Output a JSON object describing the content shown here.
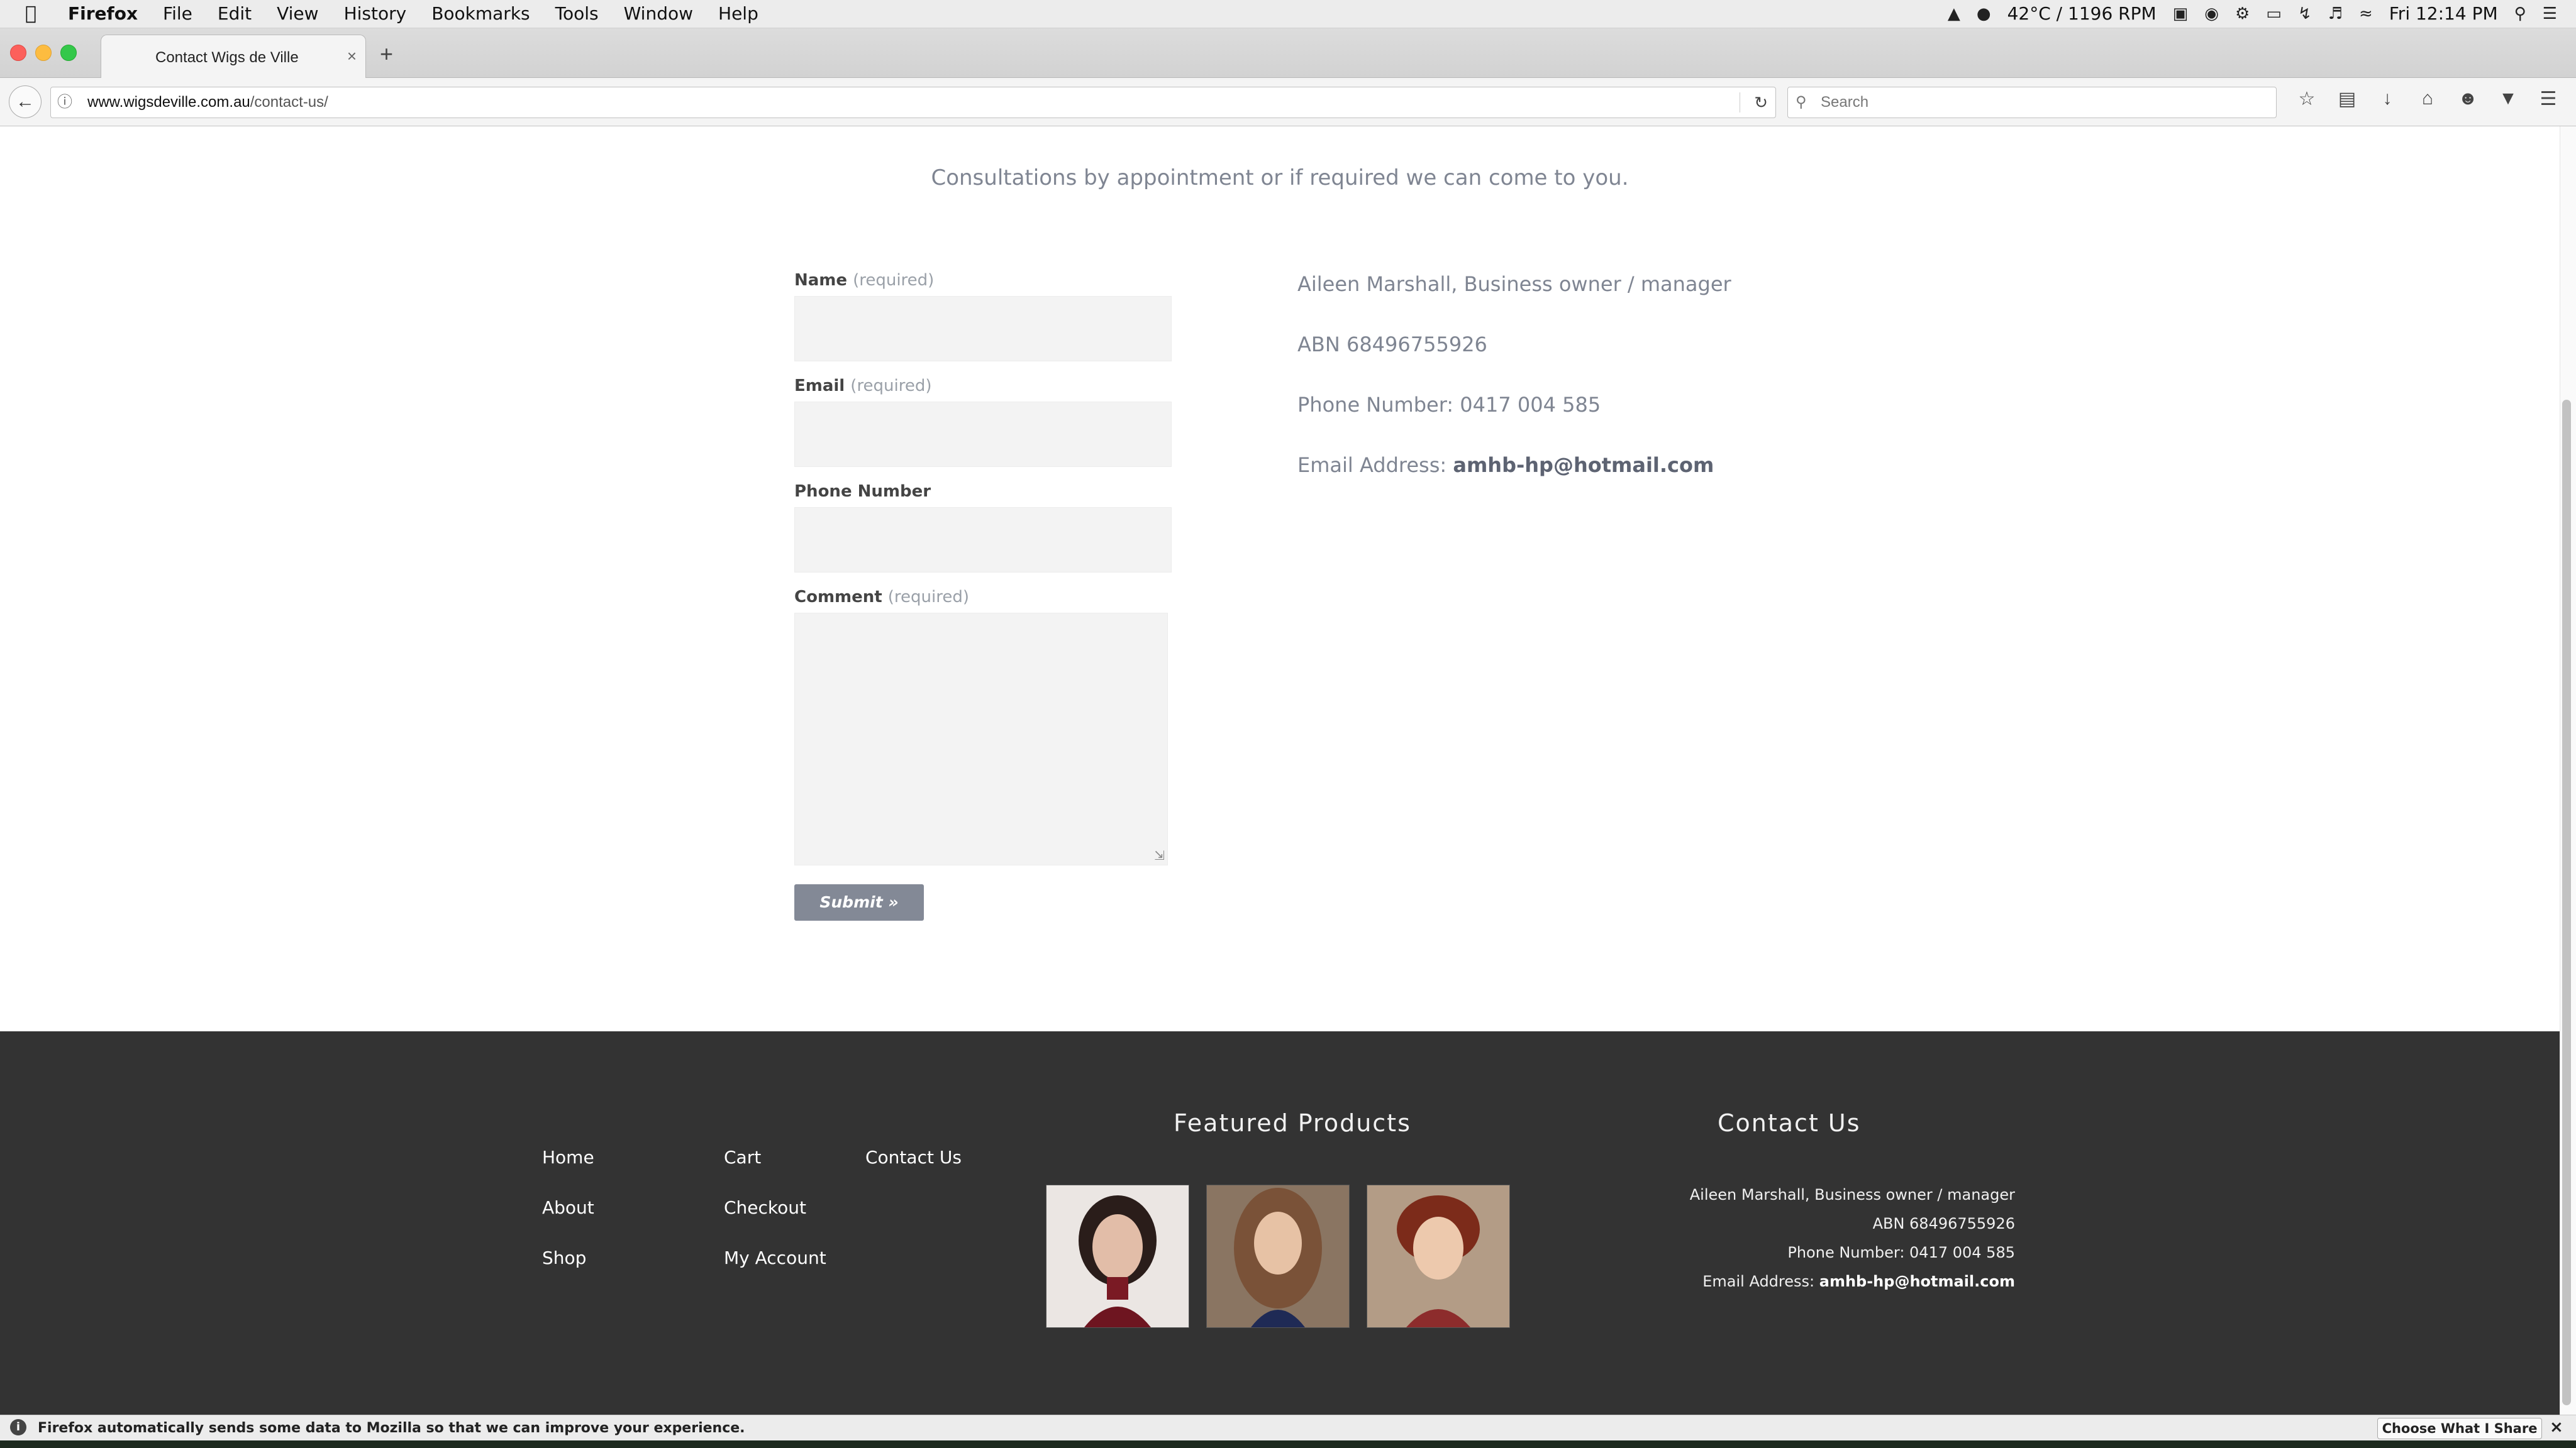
{
  "menubar": {
    "apple": "",
    "menus": [
      "Firefox",
      "File",
      "Edit",
      "View",
      "History",
      "Bookmarks",
      "Tools",
      "Window",
      "Help"
    ],
    "status_temp": "42°C / 1196 RPM",
    "clock": "Fri 12:14 PM"
  },
  "browser": {
    "tab_title": "Contact Wigs de Ville",
    "url_domain": "www.wigsdeville.com.au",
    "url_path": "/contact-us/",
    "search_placeholder": "Search"
  },
  "page": {
    "tagline": "Consultations by appointment or if required we can come to you.",
    "form": {
      "name_label": "Name",
      "email_label": "Email",
      "phone_label": "Phone Number",
      "comment_label": "Comment",
      "required_note": "(required)",
      "submit_label": "Submit »"
    },
    "info": {
      "owner": "Aileen Marshall, Business owner / manager",
      "abn": "ABN 68496755926",
      "phone": "Phone Number: 0417 004 585",
      "email_prefix": "Email Address: ",
      "email": "amhb-hp@hotmail.com"
    }
  },
  "footer": {
    "nav_col1": [
      "Home",
      "About",
      "Shop"
    ],
    "nav_col2": [
      "Cart",
      "Checkout",
      "My Account"
    ],
    "nav_col3": [
      "Contact Us"
    ],
    "featured_heading": "Featured Products",
    "contact_heading": "Contact Us",
    "contact_owner": "Aileen Marshall, Business owner / manager",
    "contact_abn": "ABN 68496755926",
    "contact_phone": "Phone Number: 0417 004 585",
    "contact_email_prefix": "Email Address: ",
    "contact_email": "amhb-hp@hotmail.com"
  },
  "notification": {
    "text": "Firefox automatically sends some data to Mozilla so that we can improve your experience.",
    "button": "Choose What I Share"
  }
}
